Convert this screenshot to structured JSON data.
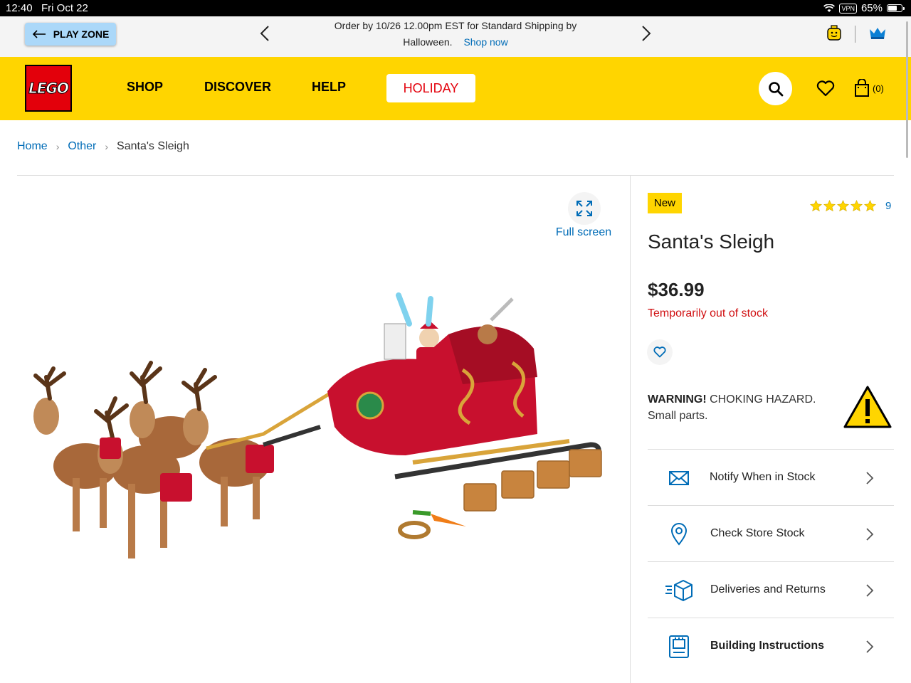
{
  "status_bar": {
    "time": "12:40",
    "date": "Fri Oct 22",
    "vpn": "VPN",
    "battery": "65%"
  },
  "promo": {
    "play_zone_label": "PLAY ZONE",
    "line1": "Order by 10/26 12.00pm EST for Standard Shipping by",
    "line2": "Halloween.",
    "shop_now": "Shop now"
  },
  "nav": {
    "logo": "LEGO",
    "items": [
      "SHOP",
      "DISCOVER",
      "HELP"
    ],
    "holiday": "HOLIDAY",
    "bag_count": "(0)"
  },
  "breadcrumb": {
    "home": "Home",
    "category": "Other",
    "current": "Santa's Sleigh"
  },
  "gallery": {
    "fullscreen_label": "Full screen"
  },
  "product": {
    "badge": "New",
    "rating": 5,
    "review_count": "9",
    "title": "Santa's Sleigh",
    "price": "$36.99",
    "stock_status": "Temporarily out of stock",
    "warning_bold": "WARNING!",
    "warning_text": " CHOKING HAZARD.",
    "warning_line2": "Small parts."
  },
  "actions": [
    {
      "label": "Notify When in Stock",
      "icon": "envelope-icon"
    },
    {
      "label": "Check Store Stock",
      "icon": "location-pin-icon"
    },
    {
      "label": "Deliveries and Returns",
      "icon": "delivery-box-icon"
    },
    {
      "label": "Building Instructions",
      "icon": "instructions-book-icon"
    }
  ],
  "colors": {
    "brand_yellow": "#ffd500",
    "brand_red": "#e3000b",
    "link_blue": "#006cb7",
    "stock_red": "#d01012"
  }
}
